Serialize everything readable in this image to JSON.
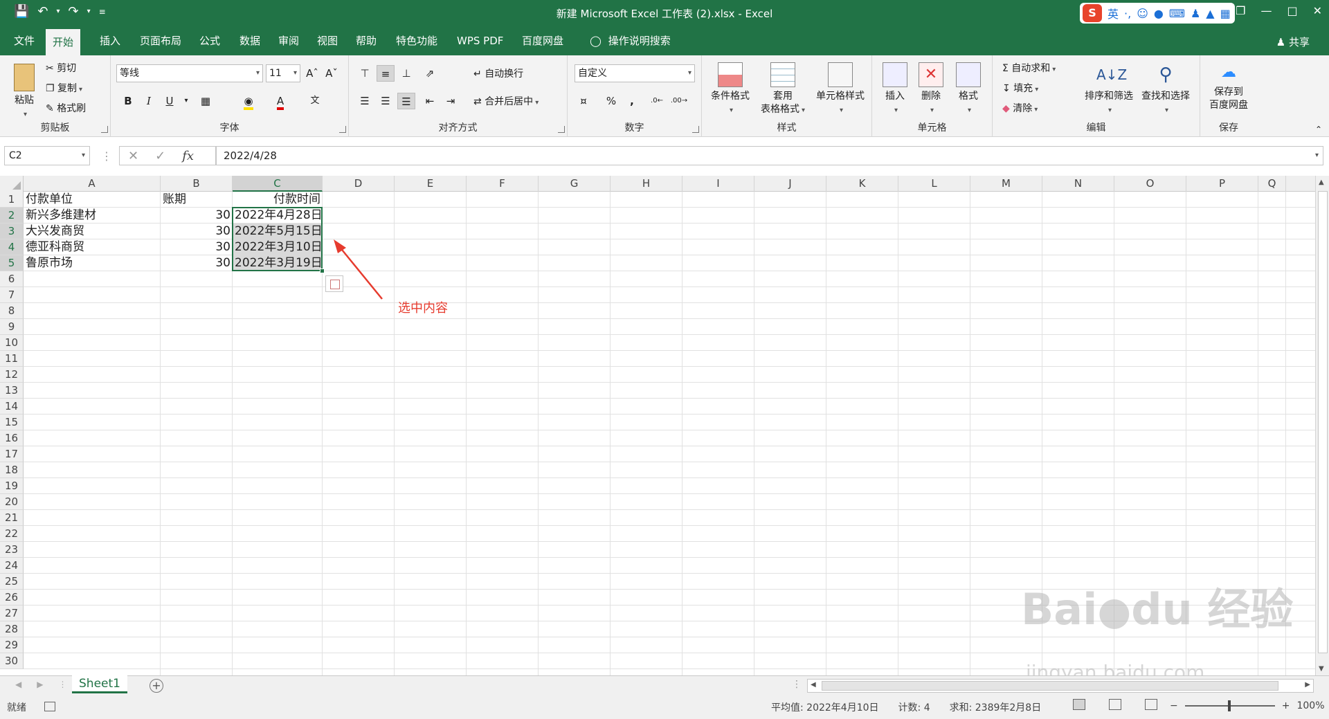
{
  "window": {
    "title": "新建 Microsoft Excel 工作表 (2).xlsx  -  Excel",
    "ime": {
      "lang": "英",
      "punct": "·,",
      "icons": [
        "smiley-icon",
        "mic-icon",
        "keyboard-icon",
        "user-icon",
        "shirt-icon",
        "grid-icon"
      ]
    }
  },
  "menu": {
    "tabs": [
      "文件",
      "开始",
      "插入",
      "页面布局",
      "公式",
      "数据",
      "审阅",
      "视图",
      "帮助",
      "特色功能",
      "WPS PDF",
      "百度网盘",
      "操作说明搜索"
    ],
    "active_tab": "开始",
    "share": "共享"
  },
  "ribbon": {
    "clipboard": {
      "label": "剪贴板",
      "paste": "粘贴",
      "cut": "剪切",
      "copy": "复制",
      "format_painter": "格式刷"
    },
    "font": {
      "label": "字体",
      "font_name": "等线",
      "font_size": "11",
      "bold": "B",
      "italic": "I",
      "underline": "U",
      "font_color": "#e00000",
      "fill_color": "#ffe000"
    },
    "alignment": {
      "label": "对齐方式",
      "wrap": "自动换行",
      "merge": "合并后居中"
    },
    "number": {
      "label": "数字",
      "format": "自定义",
      "percent": "%",
      "comma": ","
    },
    "styles": {
      "label": "样式",
      "conditional": "条件格式",
      "table_line1": "套用",
      "table_line2": "表格格式",
      "cell_styles": "单元格样式"
    },
    "cells": {
      "label": "单元格",
      "insert": "插入",
      "delete": "删除",
      "format": "格式"
    },
    "editing": {
      "label": "编辑",
      "autosum": "自动求和",
      "fill": "填充",
      "clear": "清除",
      "sort_filter": "排序和筛选",
      "find_select": "查找和选择"
    },
    "save": {
      "label": "保存",
      "line1": "保存到",
      "line2": "百度网盘"
    }
  },
  "formula_bar": {
    "name_box": "C2",
    "fx": "fx",
    "value": "2022/4/28"
  },
  "sheet": {
    "columns": [
      "A",
      "B",
      "C",
      "D",
      "E",
      "F",
      "G",
      "H",
      "I",
      "J",
      "K",
      "L",
      "M",
      "N",
      "O",
      "P",
      "Q"
    ],
    "selected_column": "C",
    "rows": [
      "1",
      "2",
      "3",
      "4",
      "5",
      "6",
      "7",
      "8",
      "9",
      "10",
      "11",
      "12",
      "13",
      "14",
      "15",
      "16",
      "17",
      "18",
      "19",
      "20",
      "21",
      "22",
      "23",
      "24",
      "25",
      "26",
      "27",
      "28",
      "29",
      "30"
    ],
    "selected_rows": [
      "2",
      "3",
      "4",
      "5"
    ],
    "cells": {
      "A1": "付款单位",
      "B1": "账期",
      "C1": "付款时间",
      "A2": "新兴多维建材",
      "B2": "30",
      "C2": "2022年4月28日",
      "A3": "大兴发商贸",
      "B3": "30",
      "C3": "2022年5月15日",
      "A4": "德亚科商贸",
      "B4": "30",
      "C4": "2022年3月10日",
      "A5": "鲁原市场",
      "B5": "30",
      "C5": "2022年3月19日"
    },
    "annotation": "选中内容",
    "annotation_color": "#e63b2e",
    "tab_name": "Sheet1"
  },
  "status": {
    "ready": "就绪",
    "average": "平均值: 2022年4月10日",
    "count": "计数: 4",
    "sum": "求和: 2389年2月8日",
    "zoom": "100%",
    "minus": "−",
    "plus": "+"
  },
  "watermark": {
    "main": "Bai●du 经验",
    "sub": "jingyan.baidu.com"
  },
  "colors": {
    "accent": "#217346",
    "selection": "#d9d9d9"
  }
}
